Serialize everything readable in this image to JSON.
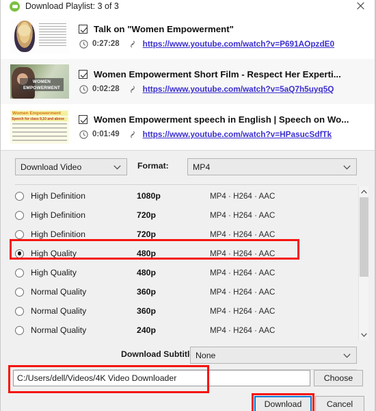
{
  "window": {
    "title": "Download Playlist: 3 of 3",
    "app_icon": "4k-downloader-icon",
    "close_label": "✕"
  },
  "playlist": {
    "items": [
      {
        "checked": true,
        "title": "Talk on \"Women Empowerment\"",
        "duration": "0:27:28",
        "url": "https://www.youtube.com/watch?v=P691AOpzdE0",
        "thumb_caption": ""
      },
      {
        "checked": true,
        "title": "Women Empowerment Short Film - Respect Her Experti...",
        "duration": "0:02:28",
        "url": "https://www.youtube.com/watch?v=5aQ7h5uyq5Q",
        "thumb_caption": "WOMEN EMPOWERMENT"
      },
      {
        "checked": true,
        "title": "Women Empowerment speech in English | Speech on Wo...",
        "duration": "0:01:49",
        "url": "https://www.youtube.com/watch?v=HPasucSdfTk",
        "thumb_caption_line1": "Women Empowerment",
        "thumb_caption_line2": "Speech for class 9,10 and above"
      }
    ]
  },
  "options": {
    "mode_select": "Download Video",
    "format_label": "Format:",
    "format_select": "MP4",
    "qualities": [
      {
        "name": "High Definition",
        "resolution": "1080p",
        "codec": "MP4 · H264 · AAC",
        "selected": false
      },
      {
        "name": "High Definition",
        "resolution": "720p",
        "codec": "MP4 · H264 · AAC",
        "selected": false
      },
      {
        "name": "High Definition",
        "resolution": "720p",
        "codec": "MP4 · H264 · AAC",
        "selected": false
      },
      {
        "name": "High Quality",
        "resolution": "480p",
        "codec": "MP4 · H264 · AAC",
        "selected": true
      },
      {
        "name": "High Quality",
        "resolution": "480p",
        "codec": "MP4 · H264 · AAC",
        "selected": false
      },
      {
        "name": "Normal Quality",
        "resolution": "360p",
        "codec": "MP4 · H264 · AAC",
        "selected": false
      },
      {
        "name": "Normal Quality",
        "resolution": "360p",
        "codec": "MP4 · H264 · AAC",
        "selected": false
      },
      {
        "name": "Normal Quality",
        "resolution": "240p",
        "codec": "MP4 · H264 · AAC",
        "selected": false
      }
    ],
    "subtitles_label": "Download Subtitles:",
    "subtitles_select": "None"
  },
  "footer": {
    "path_value": "C:/Users/dell/Videos/4K Video Downloader",
    "choose_label": "Choose",
    "download_label": "Download",
    "cancel_label": "Cancel"
  },
  "colors": {
    "accent_red": "#f5140f",
    "focus_blue": "#0078d7",
    "link_blue": "#3b2fcf",
    "brand_green": "#7bc043"
  }
}
